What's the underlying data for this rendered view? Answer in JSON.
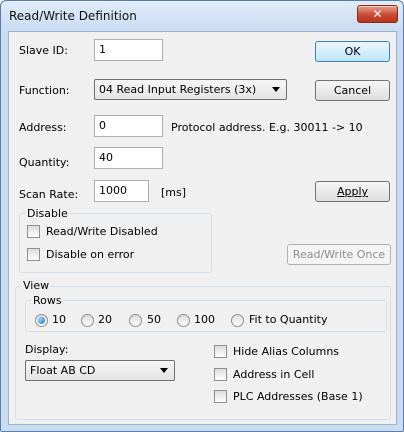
{
  "window": {
    "title": "Read/Write Definition",
    "close_glyph": "✕"
  },
  "fields": {
    "slave_id_label": "Slave ID:",
    "slave_id_value": "1",
    "function_label": "Function:",
    "function_value": "04 Read Input Registers (3x)",
    "address_label": "Address:",
    "address_value": "0",
    "address_hint": "Protocol address. E.g. 30011 -> 10",
    "quantity_label": "Quantity:",
    "quantity_value": "40",
    "scan_rate_label": "Scan Rate:",
    "scan_rate_value": "1000",
    "scan_rate_unit": "[ms]"
  },
  "buttons": {
    "ok": "OK",
    "cancel": "Cancel",
    "apply": "Apply",
    "read_write_once": "Read/Write Once"
  },
  "disable_group": {
    "title": "Disable",
    "read_write_disabled": "Read/Write Disabled",
    "disable_on_error": "Disable on error"
  },
  "view_group": {
    "title": "View",
    "rows_title": "Rows",
    "rows_options": [
      "10",
      "20",
      "50",
      "100",
      "Fit to Quantity"
    ],
    "rows_selected": "10",
    "display_label": "Display:",
    "display_value": "Float AB CD",
    "hide_alias_columns": "Hide Alias Columns",
    "address_in_cell": "Address in Cell",
    "plc_addresses": "PLC Addresses (Base 1)"
  }
}
